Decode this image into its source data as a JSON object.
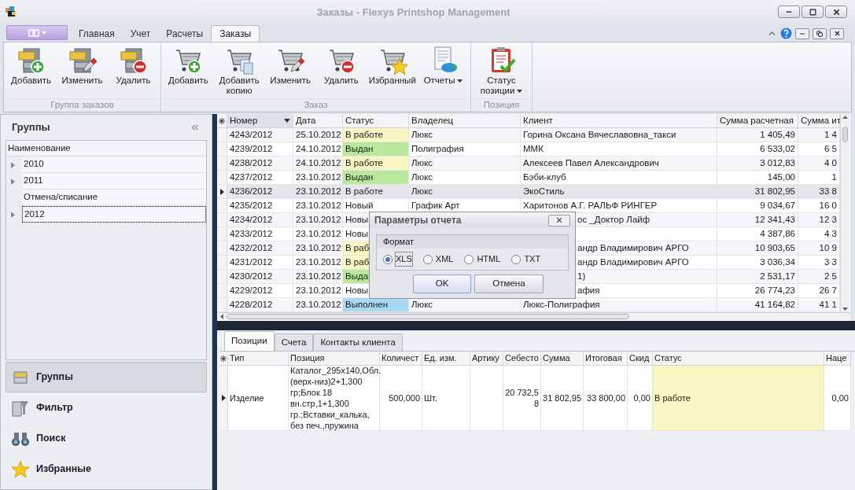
{
  "window": {
    "title": "Заказы - Flexys Printshop Management"
  },
  "ribbon": {
    "tabs": [
      {
        "label": "Главная",
        "selected": false
      },
      {
        "label": "Учет",
        "selected": false
      },
      {
        "label": "Расчеты",
        "selected": false
      },
      {
        "label": "Заказы",
        "selected": true
      }
    ],
    "groups": [
      {
        "title": "Группа заказов",
        "buttons": [
          {
            "label": "Добавить",
            "dropdown": false
          },
          {
            "label": "Изменить",
            "dropdown": false
          },
          {
            "label": "Удалить",
            "dropdown": false
          }
        ]
      },
      {
        "title": "Заказ",
        "buttons": [
          {
            "label": "Добавить",
            "dropdown": false
          },
          {
            "label": "Добавить копию",
            "dropdown": false
          },
          {
            "label": "Изменить",
            "dropdown": false
          },
          {
            "label": "Удалить",
            "dropdown": false
          },
          {
            "label": "Избранный",
            "dropdown": false
          },
          {
            "label": "Отчеты",
            "dropdown": true
          }
        ]
      },
      {
        "title": "Позиция",
        "buttons": [
          {
            "label": "Статус позиции",
            "dropdown": true
          }
        ]
      }
    ]
  },
  "left_panel": {
    "title": "Группы",
    "tree": {
      "column": "Наименование",
      "items": [
        {
          "label": "2010",
          "expandable": true,
          "selected": false
        },
        {
          "label": "2011",
          "expandable": true,
          "selected": false
        },
        {
          "label": "Отмена/списание",
          "expandable": false,
          "selected": false
        },
        {
          "label": "2012",
          "expandable": true,
          "selected": true
        }
      ]
    },
    "nav": [
      {
        "label": "Группы",
        "selected": true
      },
      {
        "label": "Фильтр",
        "selected": false
      },
      {
        "label": "Поиск",
        "selected": false
      },
      {
        "label": "Избранные",
        "selected": false
      }
    ]
  },
  "orders": {
    "columns": [
      {
        "label": "Номер",
        "sorted": true
      },
      {
        "label": "Дата",
        "sorted": false
      },
      {
        "label": "Статус",
        "sorted": false
      },
      {
        "label": "Владелец",
        "sorted": false
      },
      {
        "label": "Клиент",
        "sorted": false
      },
      {
        "label": "Сумма расчетная",
        "sorted": false
      },
      {
        "label": "Сумма ит",
        "sorted": false
      }
    ],
    "rows": [
      {
        "number": "4243/2012",
        "date": "25.10.2012",
        "status": {
          "text": "В работе",
          "color": "#f8f6c2"
        },
        "owner": "Люкс",
        "client": "Горина Оксана Вячеславовна_такси",
        "sum": "1 405,49",
        "total": "1 4",
        "selected": false
      },
      {
        "number": "4239/2012",
        "date": "24.10.2012",
        "status": {
          "text": "Выдан",
          "color": "#b9e89c"
        },
        "owner": "Полиграфия",
        "client": "ММК",
        "sum": "6 533,02",
        "total": "6 5",
        "selected": false
      },
      {
        "number": "4238/2012",
        "date": "24.10.2012",
        "status": {
          "text": "В работе",
          "color": "#f8f6c2"
        },
        "owner": "Люкс",
        "client": "Алексеев Павел Александрович",
        "sum": "3 012,83",
        "total": "4 0",
        "selected": false
      },
      {
        "number": "4237/2012",
        "date": "23.10.2012",
        "status": {
          "text": "Выдан",
          "color": "#b9e89c"
        },
        "owner": "Люкс",
        "client": "Бэби-клуб",
        "sum": "145,00",
        "total": "1",
        "selected": false
      },
      {
        "number": "4236/2012",
        "date": "23.10.2012",
        "status": {
          "text": "В работе"
        },
        "owner": "Люкс",
        "client": "ЭкоСтиль",
        "sum": "31 802,95",
        "total": "33 8",
        "selected": true
      },
      {
        "number": "4235/2012",
        "date": "23.10.2012",
        "status": {
          "text": "Новый"
        },
        "owner": "График Арт",
        "client": "Харитонов А.Г. РАЛЬФ РИНГЕР",
        "sum": "9 034,67",
        "total": "16 0",
        "selected": false
      },
      {
        "number": "4234/2012",
        "date": "23.10.2012",
        "status": {
          "text": "Новы"
        },
        "client": "ос _Доктор Лайф",
        "sum": "12 341,43",
        "total": "12 3",
        "selected": false
      },
      {
        "number": "4233/2012",
        "date": "23.10.2012",
        "status": {
          "text": "Новы"
        },
        "sum": "4 387,86",
        "total": "4 3",
        "selected": false
      },
      {
        "number": "4232/2012",
        "date": "23.10.2012",
        "status": {
          "text": "В раб",
          "color": "#f8f6c2"
        },
        "client": "андр Владимирович АРГО",
        "sum": "10 903,65",
        "total": "10 9",
        "selected": false
      },
      {
        "number": "4231/2012",
        "date": "23.10.2012",
        "status": {
          "text": "В раб",
          "color": "#f8f6c2"
        },
        "client": "андр Владимирович АРГО",
        "sum": "3 036,34",
        "total": "3 3",
        "selected": false
      },
      {
        "number": "4230/2012",
        "date": "23.10.2012",
        "status": {
          "text": "Выда",
          "color": "#b9e89c"
        },
        "client": "1)",
        "sum": "2 531,17",
        "total": "2 5",
        "selected": false
      },
      {
        "number": "4229/2012",
        "date": "23.10.2012",
        "status": {
          "text": "Новы"
        },
        "client": "афия",
        "sum": "26 774,23",
        "total": "26 7",
        "selected": false
      },
      {
        "number": "4228/2012",
        "date": "23.10.2012",
        "status": {
          "text": "Выполнен",
          "color": "#a9d9f2"
        },
        "owner": "Люкс",
        "client": "Люкс-Полиграфия",
        "sum": "41 164,82",
        "total": "41 1",
        "selected": false
      }
    ]
  },
  "dialog": {
    "title": "Параметры отчета",
    "group": "Формат",
    "options": [
      {
        "label": "XLS",
        "selected": true
      },
      {
        "label": "XML",
        "selected": false
      },
      {
        "label": "HTML",
        "selected": false
      },
      {
        "label": "TXT",
        "selected": false
      }
    ],
    "buttons": [
      {
        "label": "OK",
        "default": true
      },
      {
        "label": "Отмена",
        "default": false
      }
    ]
  },
  "details": {
    "tabs": [
      {
        "label": "Позиции",
        "selected": true
      },
      {
        "label": "Счета",
        "selected": false
      },
      {
        "label": "Контакты клиента",
        "selected": false
      }
    ],
    "columns": [
      "Тип",
      "Позиция",
      "Количест",
      "Ед. изм.",
      "Артику",
      "Себесто",
      "Сумма",
      "Итоговая",
      "Скид",
      "Статус",
      "Наце"
    ],
    "rows": [
      {
        "type": "Изделие",
        "position": "Каталог_295x140,Обл.(верх-низ)2+1,300 гр;Блок 18 вн.стр,1+1,300 гр.;Вставки_калька, без печ.,пружина",
        "quantity": "500,000",
        "unit": "Шт.",
        "cost": "20 732,58",
        "sum": "31 802,95",
        "total": "33 800,00",
        "discount": "0,00",
        "status": {
          "text": "В работе",
          "color": "#f8f6c2"
        },
        "markup": "0,00",
        "selected": true
      }
    ]
  }
}
